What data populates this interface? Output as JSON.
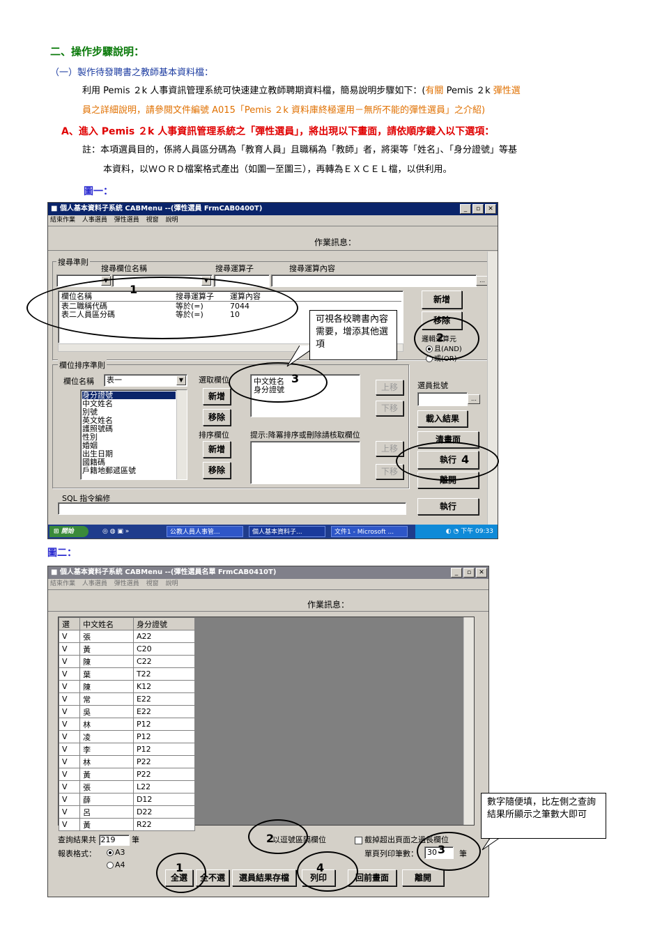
{
  "doc": {
    "section_title": "二、操作步驟說明：",
    "sub_title": "（一）製作待發聘書之教師基本資料檔：",
    "para1_a": "利用 Pemis ２k 人事資訊管理系統可快速建立教師聘期資料檔，簡易說明步驟如下：(",
    "para1_b": "有關",
    "para1_c": " Pemis ２k ",
    "para1_d": "彈性選",
    "para1_line2": "員之詳細說明，請參閱文件編號 A015「Pemis ２k 資料庫終極運用－無所不能的彈性選員」之介紹)",
    "stepA": "A、進入 Pemis ２k 人事資訊管理系統之「彈性選員」，將出現以下畫面，請依順序鍵入以下選項：",
    "note1": "註：本項選員目的，係將人員區分碼為「教育人員」且職稱為「教師」者，將渠等「姓名」、「身分證號」等基",
    "note2": "本資料，以ＷＯＲＤ檔案格式產出（如圖一至圖三），再轉為ＥＸＣＥＬ檔，以供利用。",
    "fig1_label": "圖一：",
    "fig2_label": "圖二："
  },
  "win1": {
    "title": "個人基本資料子系統 CABMenu --(彈性選員 FrmCAB0400T)",
    "menu": [
      "結束作業",
      "人事選員",
      "彈性選員",
      "視窗",
      "說明"
    ],
    "msg_label": "作業訊息：",
    "search_group": "搜尋準則",
    "col_field": "搜尋欄位名稱",
    "col_op": "搜尋運算子",
    "col_content": "搜尋運算內容",
    "list_headers": [
      "欄位名稱",
      "搜尋運算子",
      "運算內容"
    ],
    "list_rows": [
      [
        "表二職稱代碼",
        "等於(=)",
        "7044"
      ],
      [
        "表二人員區分碼",
        "等於(=)",
        "10"
      ]
    ],
    "btn_add": "新增",
    "btn_remove": "移除",
    "logic_label": "邏輯運算元",
    "logic_and": "且(AND)",
    "logic_or": "或(OR)",
    "sort_group": "欄位排序準則",
    "field_name_label": "欄位名稱",
    "table_select": "表一",
    "field_list": [
      "身分證號",
      "中文姓名",
      "別號",
      "英文姓名",
      "護照號碼",
      "性別",
      "婚姻",
      "出生日期",
      "國籍碼",
      "戶籍地郵遞區號"
    ],
    "pick_label": "選取欄位",
    "picked": [
      "中文姓名",
      "身分證號"
    ],
    "btn_add2": "新增",
    "btn_remove2": "移除",
    "sort_label": "排序欄位",
    "sort_hint": "提示:降冪排序或刪除請核取欄位",
    "btn_add3": "新增",
    "btn_remove3": "移除",
    "btn_up": "上移",
    "btn_down": "下移",
    "batch_label": "選員批號",
    "btn_load": "載入結果",
    "btn_clear": "清畫面",
    "btn_exec": "執行",
    "btn_leave": "離開",
    "sql_label": "SQL 指令編修",
    "btn_exec2": "執行",
    "callout": "可視各校聘書內容需要，增添其他選項",
    "n1": "1",
    "n2": "2",
    "n3": "3",
    "n4": "4",
    "taskbar": {
      "start": "開始",
      "items": [
        "公教人員人事管...",
        "個人基本資料子...",
        "文件1 - Microsoft ..."
      ],
      "clock": "下午 09:33"
    }
  },
  "win2": {
    "title": "個人基本資料子系統 CABMenu --(彈性選員名單 FrmCAB0410T)",
    "menu": [
      "結束作業",
      "人事選員",
      "彈性選員",
      "視窗",
      "說明"
    ],
    "msg_label": "作業訊息：",
    "headers": [
      "選",
      "中文姓名",
      "身分證號"
    ],
    "rows": [
      [
        "V",
        "張",
        "A22"
      ],
      [
        "V",
        "黃",
        "C20"
      ],
      [
        "V",
        "陳",
        "C22"
      ],
      [
        "V",
        "葉",
        "T22"
      ],
      [
        "V",
        "陳",
        "K12"
      ],
      [
        "V",
        "常",
        "E22"
      ],
      [
        "V",
        "吳",
        "E22"
      ],
      [
        "V",
        "林",
        "P12"
      ],
      [
        "V",
        "凌",
        "P12"
      ],
      [
        "V",
        "李",
        "P12"
      ],
      [
        "V",
        "林",
        "P22"
      ],
      [
        "V",
        "黃",
        "P22"
      ],
      [
        "V",
        "張",
        "L22"
      ],
      [
        "V",
        "薛",
        "D12"
      ],
      [
        "V",
        "呂",
        "D22"
      ],
      [
        "V",
        "黃",
        "R22"
      ]
    ],
    "result_label": "查詢結果共",
    "result_count": "219",
    "result_unit": "筆",
    "format_label": "報表格式：",
    "fmt_a3": "A3",
    "fmt_a4": "A4",
    "opt_pause": "以逗號區隔欄位",
    "opt_trunc": "截掉超出頁面之過長欄位",
    "per_page_label": "單頁列印筆數：",
    "per_page_value": "30",
    "per_page_unit": "筆",
    "btn_all": "全選",
    "btn_none": "全不選",
    "btn_save": "選員結果存檔",
    "btn_print": "列印",
    "btn_back": "回前畫面",
    "btn_leave": "離開",
    "callout": "數字隨便填，比左側之查詢結果所顯示之筆數大即可",
    "n1": "1",
    "n2": "2",
    "n3": "3",
    "n4": "4"
  }
}
